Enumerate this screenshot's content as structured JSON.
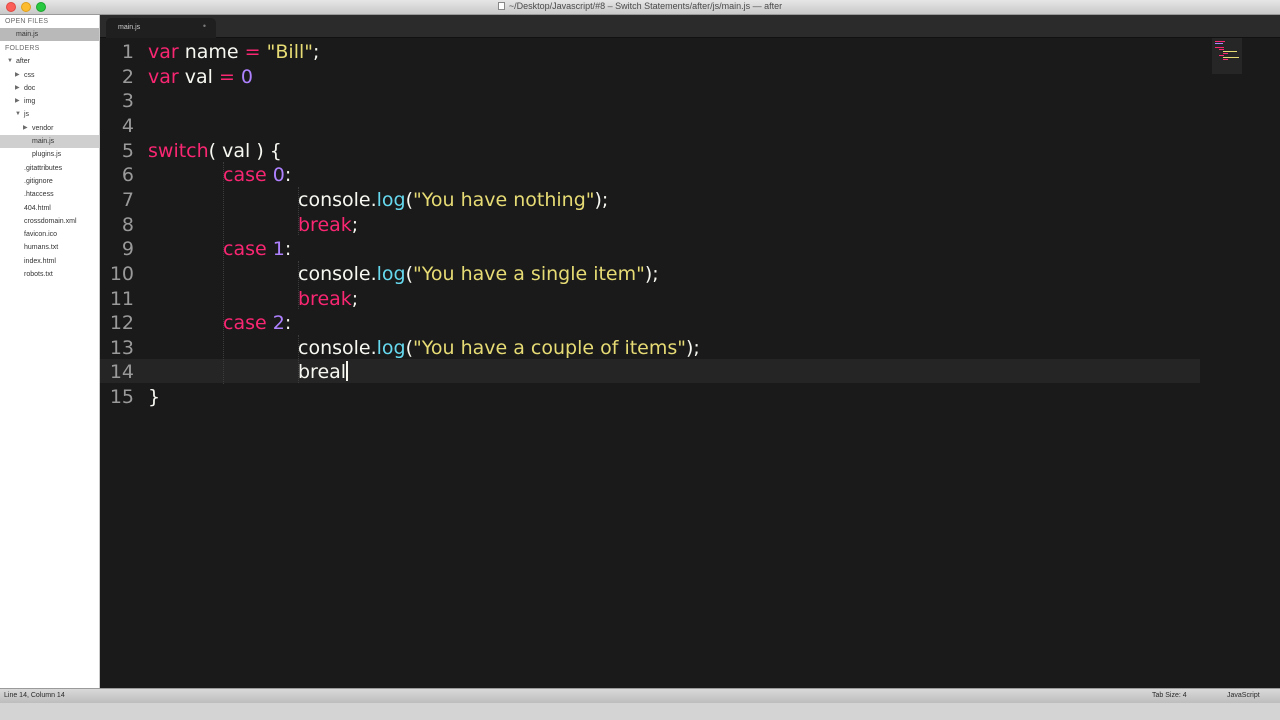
{
  "window": {
    "title": "~/Desktop/Javascript/#8 – Switch Statements/after/js/main.js — after"
  },
  "sidebar": {
    "open_files_header": "OPEN FILES",
    "open_files": [
      "main.js"
    ],
    "folders_header": "FOLDERS",
    "tree": [
      {
        "label": "after"
      },
      {
        "label": "css"
      },
      {
        "label": "doc"
      },
      {
        "label": "img"
      },
      {
        "label": "js"
      },
      {
        "label": "vendor"
      },
      {
        "label": "main.js"
      },
      {
        "label": "plugins.js"
      },
      {
        "label": ".gitattributes"
      },
      {
        "label": ".gitignore"
      },
      {
        "label": ".htaccess"
      },
      {
        "label": "404.html"
      },
      {
        "label": "crossdomain.xml"
      },
      {
        "label": "favicon.ico"
      },
      {
        "label": "humans.txt"
      },
      {
        "label": "index.html"
      },
      {
        "label": "robots.txt"
      }
    ]
  },
  "tabs": [
    {
      "label": "main.js",
      "close_glyph": "•"
    }
  ],
  "editor": {
    "line_numbers": [
      "1",
      "2",
      "3",
      "4",
      "5",
      "6",
      "7",
      "8",
      "9",
      "10",
      "11",
      "12",
      "13",
      "14",
      "15"
    ],
    "lines": {
      "l1": {
        "kw": "var",
        "t1": " name ",
        "op": "=",
        "t2": " ",
        "str": "\"Bill\"",
        "t3": ";"
      },
      "l2": {
        "kw": "var",
        "t1": " val ",
        "op": "=",
        "t2": " ",
        "num": "0"
      },
      "l5": {
        "kw": "switch",
        "t1": "( val ) {"
      },
      "l6": {
        "kw": "case",
        "t1": " ",
        "num": "0",
        "t2": ":"
      },
      "l7": {
        "t1": "console",
        "t2": ".",
        "fn": "log",
        "t3": "(",
        "str": "\"You have nothing\"",
        "t4": ");"
      },
      "l8": {
        "kw": "break",
        "t1": ";"
      },
      "l9": {
        "kw": "case",
        "t1": " ",
        "num": "1",
        "t2": ":"
      },
      "l10": {
        "t1": "console",
        "t2": ".",
        "fn": "log",
        "t3": "(",
        "str": "\"You have a single item\"",
        "t4": ");"
      },
      "l11": {
        "kw": "break",
        "t1": ";"
      },
      "l12": {
        "kw": "case",
        "t1": " ",
        "num": "2",
        "t2": ":"
      },
      "l13": {
        "t1": "console",
        "t2": ".",
        "fn": "log",
        "t3": "(",
        "str": "\"You have a couple of items\"",
        "t4": ");"
      },
      "l14": {
        "t1": "breal"
      },
      "l15": {
        "t1": "}"
      }
    }
  },
  "statusbar": {
    "position": "Line 14, Column 14",
    "tab_size": "Tab Size: 4",
    "syntax": "JavaScript"
  },
  "colors": {
    "keyword": "#f92672",
    "string": "#e6db74",
    "number": "#ae81ff",
    "function": "#66d9ef",
    "background": "#1a1a1a"
  }
}
